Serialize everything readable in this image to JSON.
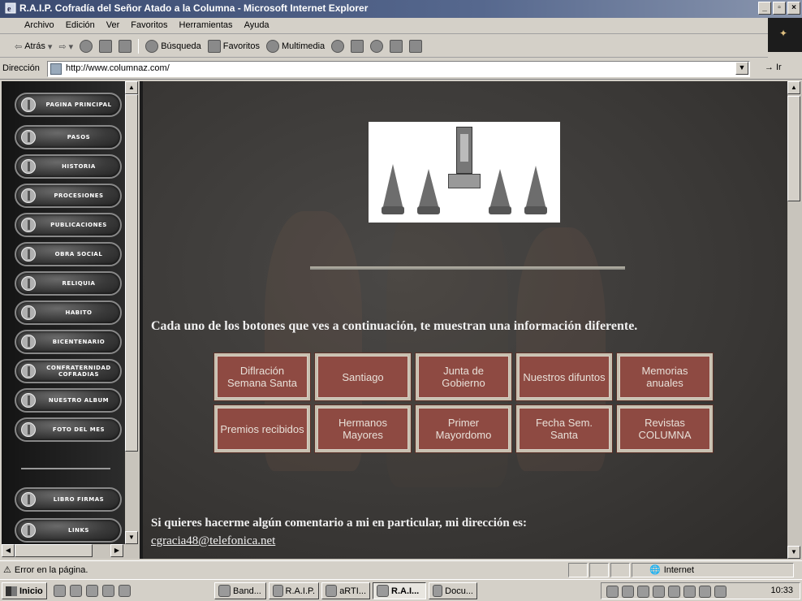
{
  "window": {
    "title": "R.A.I.P. Cofradía del Señor Atado a la Columna - Microsoft Internet Explorer",
    "controls": [
      "_",
      "▫",
      "×"
    ]
  },
  "menu": [
    "Archivo",
    "Edición",
    "Ver",
    "Favoritos",
    "Herramientas",
    "Ayuda"
  ],
  "toolbar": {
    "back": "Atrás",
    "search": "Búsqueda",
    "favorites": "Favoritos",
    "multimedia": "Multimedia"
  },
  "address": {
    "label": "Dirección",
    "url": "http://www.columnaz.com/",
    "go": "Ir"
  },
  "nav": [
    "PAGINA PRINCIPAL",
    "PASOS",
    "HISTORIA",
    "PROCESIONES",
    "PUBLICACIONES",
    "OBRA SOCIAL",
    "RELIQUIA",
    "HABITO",
    "BICENTENARIO",
    "CONFRATERNIDAD COFRADIAS",
    "NUESTRO ALBUM",
    "FOTO DEL MES",
    "LIBRO FIRMAS",
    "LINKS"
  ],
  "main": {
    "intro": "Cada uno de los botones que ves a continuación, te muestran una información diferente.",
    "buttons": [
      "Diflración Semana Santa",
      "Santiago",
      "Junta de Gobierno",
      "Nuestros difuntos",
      "Memorias anuales",
      "Premios recibidos",
      "Hermanos Mayores",
      "Primer Mayordomo",
      "Fecha Sem. Santa",
      "Revistas COLUMNA"
    ],
    "comment": "Si quieres hacerme algún comentario a mi en particular, mi dirección es:",
    "email": "cgracia48@telefonica.net"
  },
  "status": {
    "text": "Error en la página.",
    "zone": "Internet"
  },
  "taskbar": {
    "start": "Inicio",
    "tasks": [
      "Band...",
      "R.A.I.P.",
      "aRTI...",
      "R.A.I...",
      "Docu..."
    ],
    "clock": "10:33"
  },
  "colors": {
    "title_bar": "#3a4a70",
    "button_fill": "#8e4a42",
    "page_bg": "#3a3836"
  }
}
